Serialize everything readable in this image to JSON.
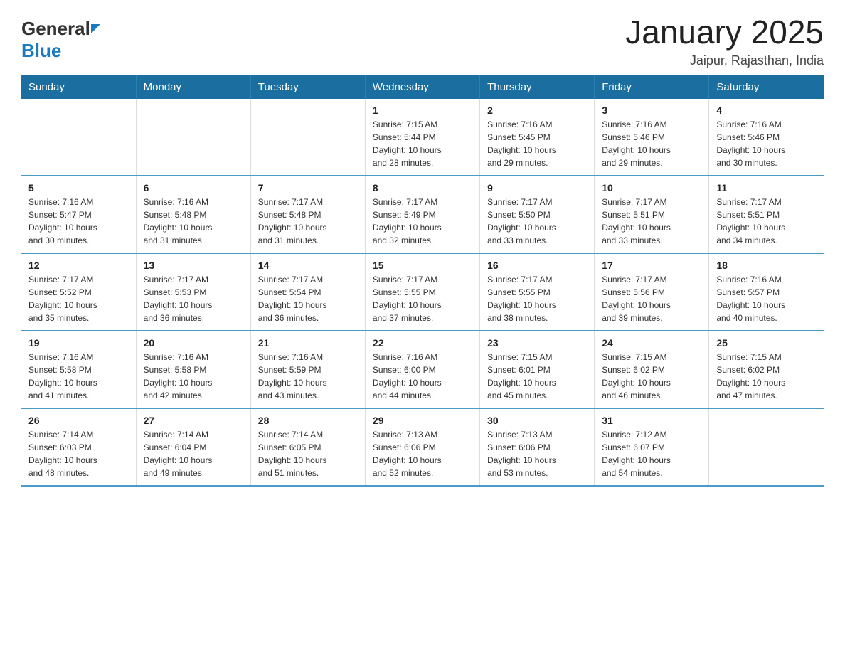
{
  "header": {
    "logo_general": "General",
    "logo_blue": "Blue",
    "month_title": "January 2025",
    "location": "Jaipur, Rajasthan, India"
  },
  "days_of_week": [
    "Sunday",
    "Monday",
    "Tuesday",
    "Wednesday",
    "Thursday",
    "Friday",
    "Saturday"
  ],
  "weeks": [
    [
      {
        "day": "",
        "info": ""
      },
      {
        "day": "",
        "info": ""
      },
      {
        "day": "",
        "info": ""
      },
      {
        "day": "1",
        "info": "Sunrise: 7:15 AM\nSunset: 5:44 PM\nDaylight: 10 hours\nand 28 minutes."
      },
      {
        "day": "2",
        "info": "Sunrise: 7:16 AM\nSunset: 5:45 PM\nDaylight: 10 hours\nand 29 minutes."
      },
      {
        "day": "3",
        "info": "Sunrise: 7:16 AM\nSunset: 5:46 PM\nDaylight: 10 hours\nand 29 minutes."
      },
      {
        "day": "4",
        "info": "Sunrise: 7:16 AM\nSunset: 5:46 PM\nDaylight: 10 hours\nand 30 minutes."
      }
    ],
    [
      {
        "day": "5",
        "info": "Sunrise: 7:16 AM\nSunset: 5:47 PM\nDaylight: 10 hours\nand 30 minutes."
      },
      {
        "day": "6",
        "info": "Sunrise: 7:16 AM\nSunset: 5:48 PM\nDaylight: 10 hours\nand 31 minutes."
      },
      {
        "day": "7",
        "info": "Sunrise: 7:17 AM\nSunset: 5:48 PM\nDaylight: 10 hours\nand 31 minutes."
      },
      {
        "day": "8",
        "info": "Sunrise: 7:17 AM\nSunset: 5:49 PM\nDaylight: 10 hours\nand 32 minutes."
      },
      {
        "day": "9",
        "info": "Sunrise: 7:17 AM\nSunset: 5:50 PM\nDaylight: 10 hours\nand 33 minutes."
      },
      {
        "day": "10",
        "info": "Sunrise: 7:17 AM\nSunset: 5:51 PM\nDaylight: 10 hours\nand 33 minutes."
      },
      {
        "day": "11",
        "info": "Sunrise: 7:17 AM\nSunset: 5:51 PM\nDaylight: 10 hours\nand 34 minutes."
      }
    ],
    [
      {
        "day": "12",
        "info": "Sunrise: 7:17 AM\nSunset: 5:52 PM\nDaylight: 10 hours\nand 35 minutes."
      },
      {
        "day": "13",
        "info": "Sunrise: 7:17 AM\nSunset: 5:53 PM\nDaylight: 10 hours\nand 36 minutes."
      },
      {
        "day": "14",
        "info": "Sunrise: 7:17 AM\nSunset: 5:54 PM\nDaylight: 10 hours\nand 36 minutes."
      },
      {
        "day": "15",
        "info": "Sunrise: 7:17 AM\nSunset: 5:55 PM\nDaylight: 10 hours\nand 37 minutes."
      },
      {
        "day": "16",
        "info": "Sunrise: 7:17 AM\nSunset: 5:55 PM\nDaylight: 10 hours\nand 38 minutes."
      },
      {
        "day": "17",
        "info": "Sunrise: 7:17 AM\nSunset: 5:56 PM\nDaylight: 10 hours\nand 39 minutes."
      },
      {
        "day": "18",
        "info": "Sunrise: 7:16 AM\nSunset: 5:57 PM\nDaylight: 10 hours\nand 40 minutes."
      }
    ],
    [
      {
        "day": "19",
        "info": "Sunrise: 7:16 AM\nSunset: 5:58 PM\nDaylight: 10 hours\nand 41 minutes."
      },
      {
        "day": "20",
        "info": "Sunrise: 7:16 AM\nSunset: 5:58 PM\nDaylight: 10 hours\nand 42 minutes."
      },
      {
        "day": "21",
        "info": "Sunrise: 7:16 AM\nSunset: 5:59 PM\nDaylight: 10 hours\nand 43 minutes."
      },
      {
        "day": "22",
        "info": "Sunrise: 7:16 AM\nSunset: 6:00 PM\nDaylight: 10 hours\nand 44 minutes."
      },
      {
        "day": "23",
        "info": "Sunrise: 7:15 AM\nSunset: 6:01 PM\nDaylight: 10 hours\nand 45 minutes."
      },
      {
        "day": "24",
        "info": "Sunrise: 7:15 AM\nSunset: 6:02 PM\nDaylight: 10 hours\nand 46 minutes."
      },
      {
        "day": "25",
        "info": "Sunrise: 7:15 AM\nSunset: 6:02 PM\nDaylight: 10 hours\nand 47 minutes."
      }
    ],
    [
      {
        "day": "26",
        "info": "Sunrise: 7:14 AM\nSunset: 6:03 PM\nDaylight: 10 hours\nand 48 minutes."
      },
      {
        "day": "27",
        "info": "Sunrise: 7:14 AM\nSunset: 6:04 PM\nDaylight: 10 hours\nand 49 minutes."
      },
      {
        "day": "28",
        "info": "Sunrise: 7:14 AM\nSunset: 6:05 PM\nDaylight: 10 hours\nand 51 minutes."
      },
      {
        "day": "29",
        "info": "Sunrise: 7:13 AM\nSunset: 6:06 PM\nDaylight: 10 hours\nand 52 minutes."
      },
      {
        "day": "30",
        "info": "Sunrise: 7:13 AM\nSunset: 6:06 PM\nDaylight: 10 hours\nand 53 minutes."
      },
      {
        "day": "31",
        "info": "Sunrise: 7:12 AM\nSunset: 6:07 PM\nDaylight: 10 hours\nand 54 minutes."
      },
      {
        "day": "",
        "info": ""
      }
    ]
  ]
}
